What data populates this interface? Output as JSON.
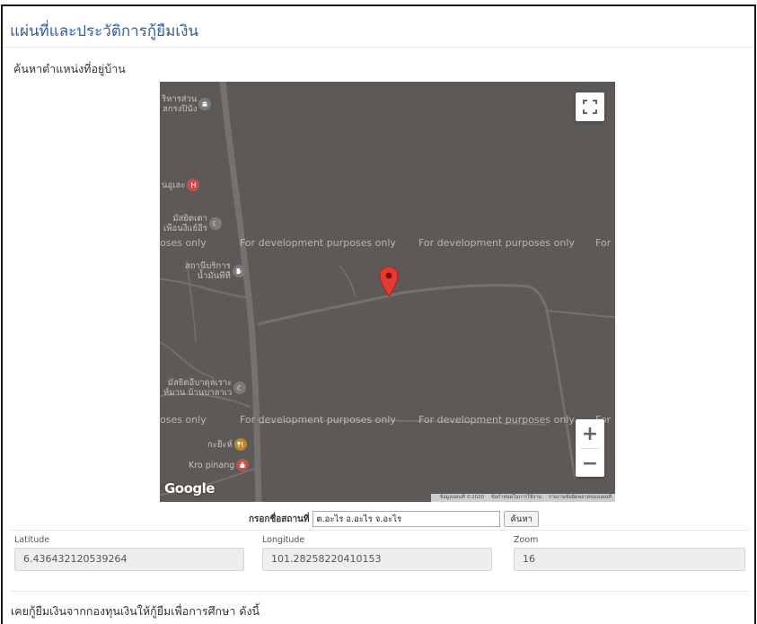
{
  "page": {
    "title": "แผ่นที่และประวัติการกู้ยืมเงิน",
    "section_title": "ค้นหาตำแหน่งที่อยู่บ้าน"
  },
  "map": {
    "watermark": "For development purposes only",
    "watermark_partial_left": "oses only",
    "watermark_partial_right": "For",
    "watermark_overlap": "Fo",
    "background_color": "#5c5957",
    "marker_color": "#e53935",
    "pois": [
      {
        "label": "ริหารส่วน\nลกรงปินัง",
        "icon": "government-icon",
        "color": "#7a7a7a"
      },
      {
        "label": "นอูเละ",
        "icon": "hospital-icon",
        "color": "#c0504d"
      },
      {
        "label": "มัสยิดเตา\nเพือนงีแย์อีร",
        "icon": "mosque-icon",
        "color": "#7a7a7a"
      },
      {
        "label": "สถานีบริการ\nน้ำมันพีที",
        "icon": "gas-station-icon",
        "color": "#7a7a7a"
      },
      {
        "label": "มัสยิดอีบาดุลเราะ\nห์มาน บ้านบาลาเว",
        "icon": "mosque-icon",
        "color": "#7a7a7a"
      },
      {
        "label": "กะยีะห์",
        "icon": "restaurant-icon",
        "color": "#b8862b"
      },
      {
        "label": "Kro pinang",
        "icon": "shopping-icon",
        "color": "#c0504d"
      }
    ],
    "google_logo": "Google",
    "attribution": {
      "map_data": "ข้อมูลแผนที่ ©2020",
      "terms": "ข้อกำหนดในการใช้งาน",
      "report": "รายงานข้อผิดพลาดของแผนที่"
    },
    "zoom_in_label": "+",
    "zoom_out_label": "−"
  },
  "place_search": {
    "label": "กรอกชื่อสถานที่",
    "value": "ต.อะไร อ.อะไร จ.อะไร",
    "button_label": "ค้นหา"
  },
  "coordinates": {
    "latitude_label": "Latitude",
    "latitude_value": "6.436432120539264",
    "longitude_label": "Longitude",
    "longitude_value": "101.28258220410153",
    "zoom_label": "Zoom",
    "zoom_value": "16"
  },
  "loan_section": {
    "title": "เคยกู้ยืมเงินจากกองทุนเงินให้กู้ยืมเพื่อการศึกษา ดังนี้"
  }
}
